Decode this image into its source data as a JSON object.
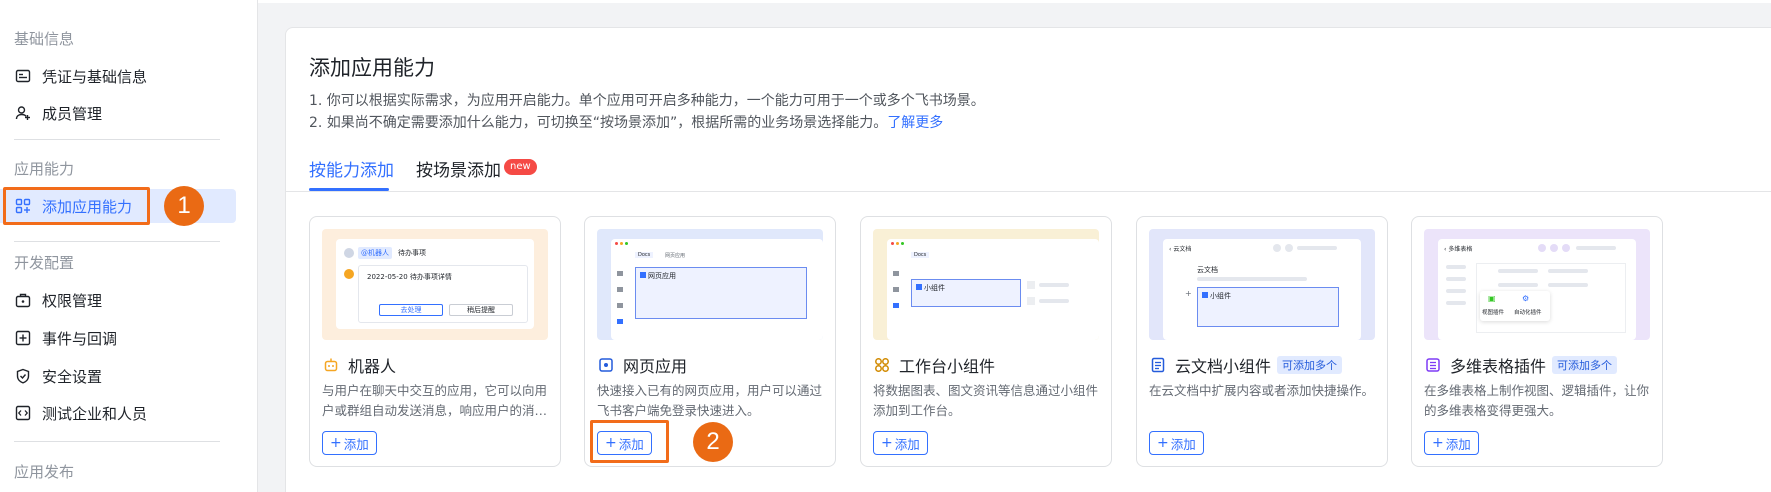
{
  "sidebar": {
    "sections": [
      {
        "label": "基础信息"
      },
      {
        "label": "应用能力"
      },
      {
        "label": "开发配置"
      },
      {
        "label": "应用发布"
      }
    ],
    "items": [
      {
        "label": "凭证与基础信息",
        "icon": "id-card-icon"
      },
      {
        "label": "成员管理",
        "icon": "add-member-icon"
      },
      {
        "label": "添加应用能力",
        "icon": "add-grid-icon",
        "active": true
      },
      {
        "label": "权限管理",
        "icon": "briefcase-icon"
      },
      {
        "label": "事件与回调",
        "icon": "event-icon"
      },
      {
        "label": "安全设置",
        "icon": "shield-icon"
      },
      {
        "label": "测试企业和人员",
        "icon": "code-icon"
      }
    ]
  },
  "annotations": {
    "step1": "1",
    "step2": "2"
  },
  "main": {
    "title": "添加应用能力",
    "desc1": "1. 你可以根据实际需求，为应用开启能力。单个应用可开启多种能力，一个能力可用于一个或多个飞书场景。",
    "desc2": "2. 如果尚不确定需要添加什么能力，可切换至“按场景添加”，根据所需的业务场景选择能力。",
    "learn_more": "了解更多",
    "tabs": [
      {
        "label": "按能力添加",
        "active": true
      },
      {
        "label": "按场景添加",
        "badge": "new"
      }
    ],
    "add_label": "添加",
    "cards": [
      {
        "title": "机器人",
        "icon": "robot-icon",
        "desc": "与用户在聊天中交互的应用，它可以向用户或群组自动发送消息，响应用户的消…",
        "mock": {
          "mention": "@机器人",
          "todo": "待办事项",
          "date": "2022-05-20 待办事项详情",
          "btn1": "去处理",
          "btn2": "稍后提醒"
        }
      },
      {
        "title": "网页应用",
        "icon": "web-app-icon",
        "desc": "快速接入已有的网页应用，用户可以通过飞书客户端免登录快速进入。",
        "mock": {
          "tab1": "Docs",
          "tab2": "网页应用",
          "box": "网页应用"
        }
      },
      {
        "title": "工作台小组件",
        "icon": "widget-icon",
        "desc": "将数据图表、图文资讯等信息通过小组件添加到工作台。",
        "mock": {
          "tab1": "Docs",
          "box": "小组件"
        }
      },
      {
        "title": "云文档小组件",
        "icon": "doc-icon",
        "tag": "可添加多个",
        "desc": "在云文档中扩展内容或者添加快捷操作。",
        "mock": {
          "header": "云文档",
          "doc": "云文档",
          "box": "小组件"
        }
      },
      {
        "title": "多维表格插件",
        "icon": "bitable-icon",
        "tag": "可添加多个",
        "desc": "在多维表格上制作视图、逻辑插件，让你的多维表格变得更强大。",
        "mock": {
          "header": "多维表格",
          "p1": "视图插件",
          "p2": "自动化插件"
        }
      }
    ]
  },
  "colors": {
    "accent": "#3370ff",
    "highlight": "#f26c1a",
    "active_bg": "#e1eaff"
  }
}
